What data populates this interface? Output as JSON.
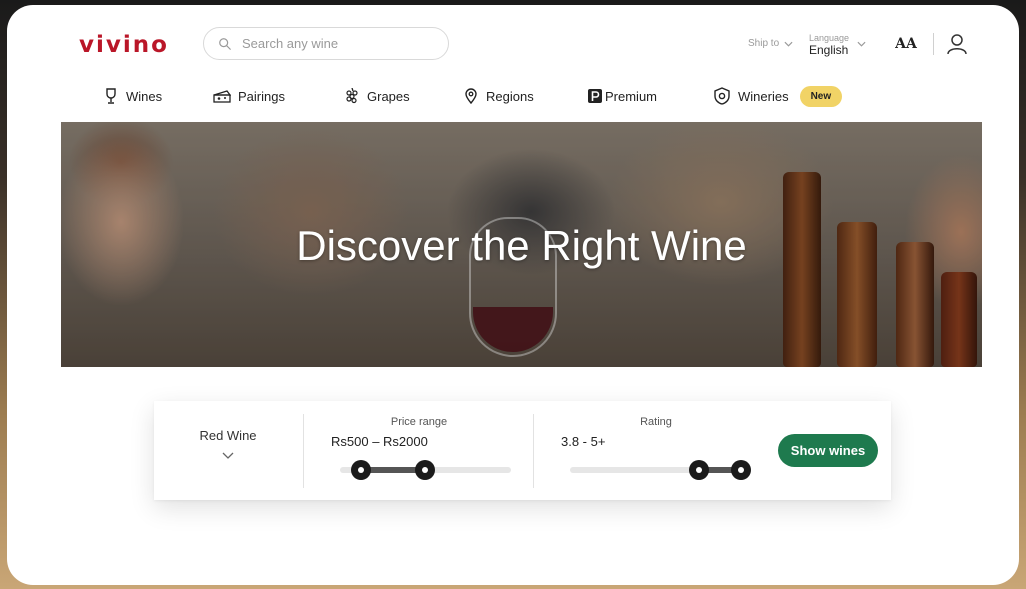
{
  "brand": {
    "logo_text": "vivino",
    "color": "#ba1628"
  },
  "search": {
    "placeholder": "Search any wine",
    "icon": "search-icon"
  },
  "header": {
    "ship_to_label": "Ship to",
    "language_label": "Language",
    "language_value": "English",
    "font_size_button": "AA"
  },
  "nav": {
    "items": [
      {
        "label": "Wines",
        "icon": "wine-glass-icon"
      },
      {
        "label": "Pairings",
        "icon": "cheese-icon"
      },
      {
        "label": "Grapes",
        "icon": "grapes-icon"
      },
      {
        "label": "Regions",
        "icon": "map-pin-icon"
      },
      {
        "label": "Premium",
        "icon": "premium-icon"
      },
      {
        "label": "Wineries",
        "icon": "shield-icon",
        "badge": "New"
      }
    ]
  },
  "hero": {
    "title": "Discover the Right Wine"
  },
  "filters": {
    "wine_type": "Red Wine",
    "price": {
      "label": "Price range",
      "value_text": "Rs500 – Rs2000",
      "range": [
        500,
        2000
      ]
    },
    "rating": {
      "label": "Rating",
      "value_text": "3.8 - 5+",
      "range": [
        3.8,
        5
      ]
    },
    "submit_label": "Show wines"
  },
  "colors": {
    "accent_green": "#1e7a4e",
    "badge_yellow": "#f1d366"
  }
}
